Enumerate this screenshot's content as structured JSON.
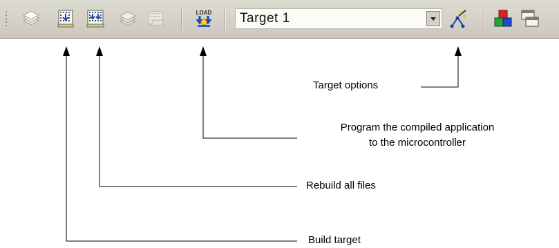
{
  "toolbar": {
    "target_select": {
      "selected": "Target 1"
    },
    "load_button_text": "LOAD",
    "icons": [
      "translate-icon",
      "build-target-icon",
      "rebuild-all-icon",
      "batch-build-icon",
      "stop-build-icon",
      "download-program-icon",
      "target-options-icon",
      "manage-components-icon",
      "select-device-icon"
    ]
  },
  "annotations": {
    "target_options": "Target options",
    "program_line1": "Program the compiled application",
    "program_line2": "to the microcontroller",
    "rebuild_all": "Rebuild all files",
    "build_target": "Build target"
  }
}
